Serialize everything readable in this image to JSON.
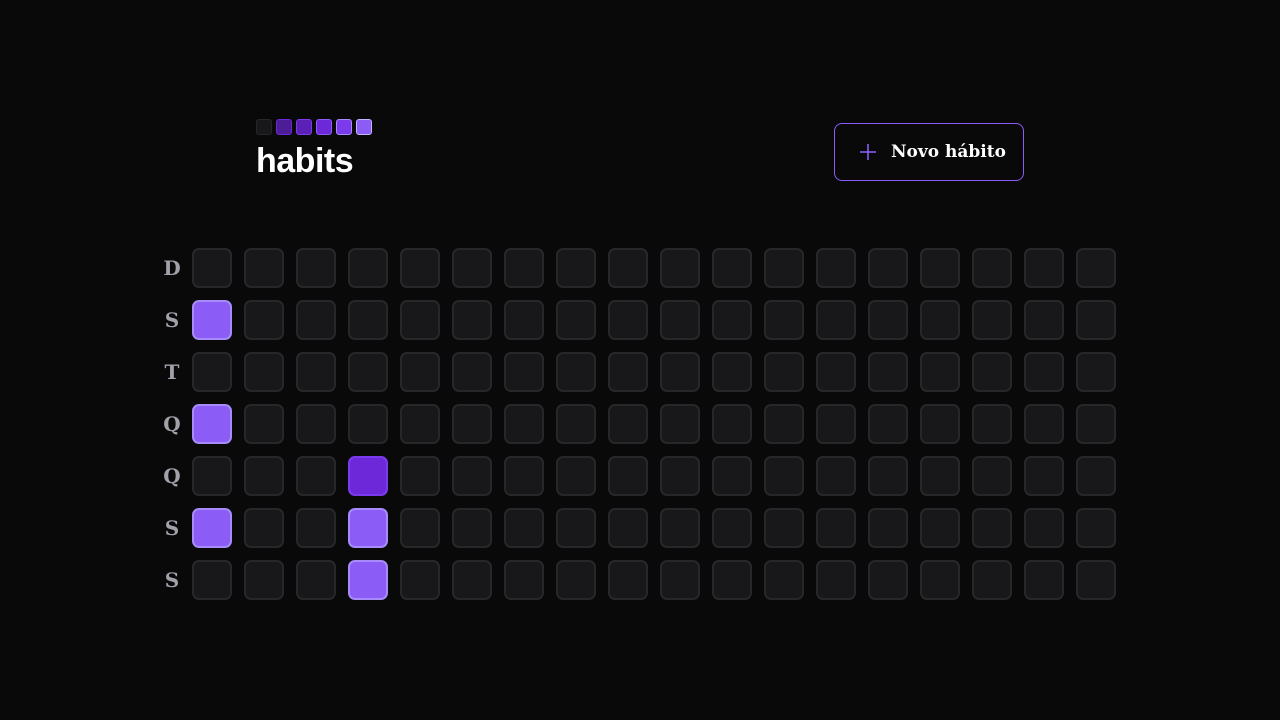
{
  "header": {
    "app_title": "habits",
    "logo_squares": [
      {
        "bg": "#18181b",
        "border": "#27272a"
      },
      {
        "bg": "#4c1d95",
        "border": "#6d28d9"
      },
      {
        "bg": "#5b21b6",
        "border": "#7c3aed"
      },
      {
        "bg": "#6d28d9",
        "border": "#8b5cf6"
      },
      {
        "bg": "#7c3aed",
        "border": "#a78bfa"
      },
      {
        "bg": "#8b5cf6",
        "border": "#c4b5fd"
      }
    ],
    "new_habit_button": {
      "label": "Novo hábito",
      "icon": "plus-icon"
    }
  },
  "colors": {
    "background": "#09090a",
    "accent": "#8b5cf6",
    "empty_cell_bg": "#18181b",
    "empty_cell_border": "#27272a",
    "day_label": "#a1a1aa"
  },
  "levels": [
    {
      "bg": "#18181b",
      "border": "#27272a"
    },
    {
      "bg": "#6d28d9",
      "border": "#7c3aed"
    },
    {
      "bg": "#8b5cf6",
      "border": "#a78bfa"
    }
  ],
  "week_days": [
    "D",
    "S",
    "T",
    "Q",
    "Q",
    "S",
    "S"
  ],
  "summary_grid": [
    [
      0,
      0,
      0,
      0,
      0,
      0,
      0,
      0,
      0,
      0,
      0,
      0,
      0,
      0,
      0,
      0,
      0,
      0
    ],
    [
      2,
      0,
      0,
      0,
      0,
      0,
      0,
      0,
      0,
      0,
      0,
      0,
      0,
      0,
      0,
      0,
      0,
      0
    ],
    [
      0,
      0,
      0,
      0,
      0,
      0,
      0,
      0,
      0,
      0,
      0,
      0,
      0,
      0,
      0,
      0,
      0,
      0
    ],
    [
      2,
      0,
      0,
      0,
      0,
      0,
      0,
      0,
      0,
      0,
      0,
      0,
      0,
      0,
      0,
      0,
      0,
      0
    ],
    [
      0,
      0,
      0,
      1,
      0,
      0,
      0,
      0,
      0,
      0,
      0,
      0,
      0,
      0,
      0,
      0,
      0,
      0
    ],
    [
      2,
      0,
      0,
      2,
      0,
      0,
      0,
      0,
      0,
      0,
      0,
      0,
      0,
      0,
      0,
      0,
      0,
      0
    ],
    [
      0,
      0,
      0,
      2,
      0,
      0,
      0,
      0,
      0,
      0,
      0,
      0,
      0,
      0,
      0,
      0,
      0,
      0
    ]
  ]
}
